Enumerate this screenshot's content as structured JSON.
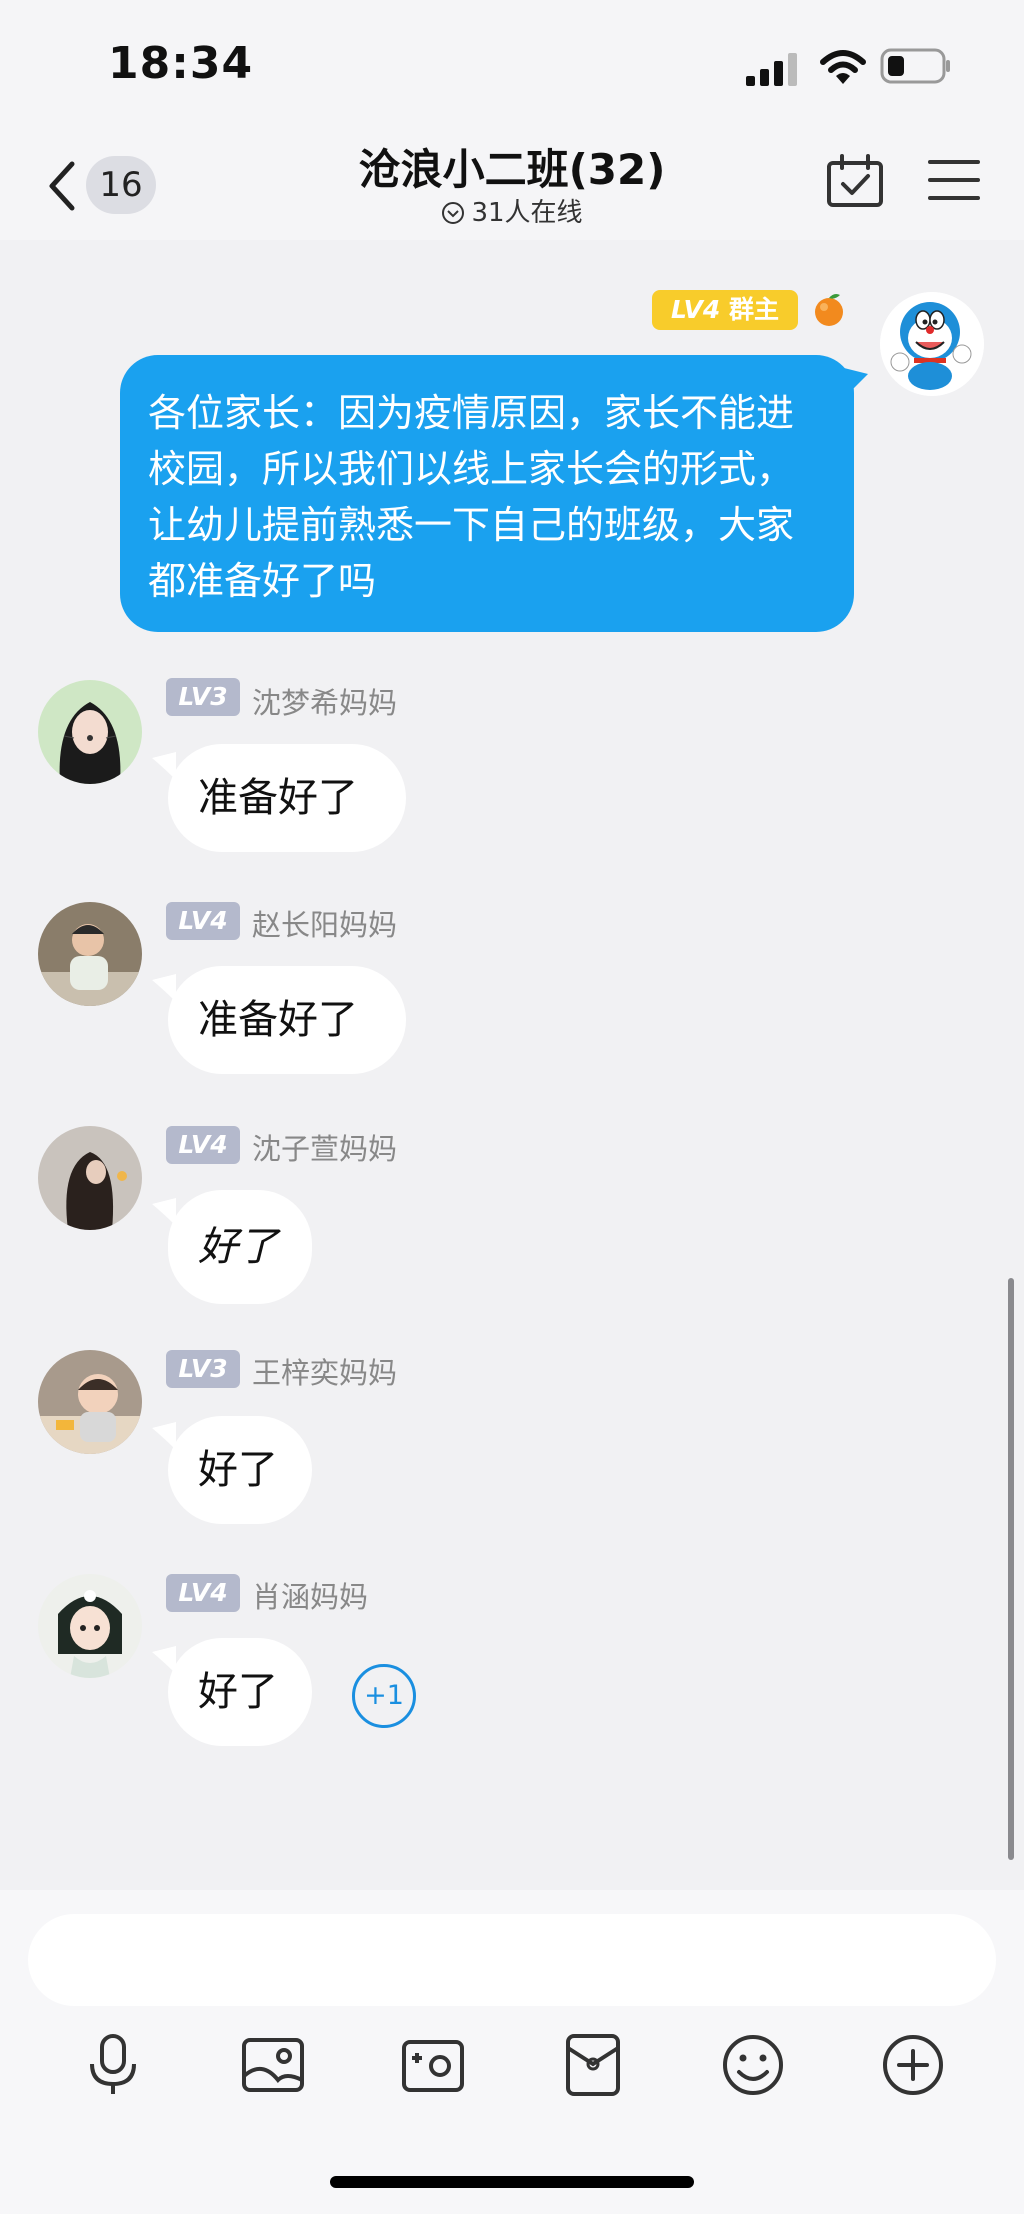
{
  "status_bar": {
    "time": "18:34"
  },
  "header": {
    "back_badge": "16",
    "title": "沧浪小二班(32)",
    "online": "31人在线"
  },
  "owner_message": {
    "level": "LV4",
    "role": "群主",
    "text": "各位家长：因为疫情原因，家长不能进校园，所以我们以线上家长会的形式，让幼儿提前熟悉一下自己的班级，大家都准备好了吗"
  },
  "replies": [
    {
      "level": "LV3",
      "name": "沈梦希妈妈",
      "text": "准备好了"
    },
    {
      "level": "LV4",
      "name": "赵长阳妈妈",
      "text": "准备好了"
    },
    {
      "level": "LV4",
      "name": "沈子萱妈妈",
      "text": "好了"
    },
    {
      "level": "LV3",
      "name": "王梓奕妈妈",
      "text": "好了"
    },
    {
      "level": "LV4",
      "name": "肖涵妈妈",
      "text": "好了"
    }
  ],
  "plus_one": "+1",
  "input": {
    "value": "",
    "placeholder": ""
  },
  "toolbar_icons": [
    "microphone-icon",
    "photo-icon",
    "camera-icon",
    "red-packet-icon",
    "emoji-icon",
    "plus-icon"
  ],
  "colors": {
    "owner_bubble": "#1aa1ef",
    "owner_tag": "#f8cc2b",
    "level_tag": "#b4b9cc",
    "accent": "#1a8fe0"
  }
}
